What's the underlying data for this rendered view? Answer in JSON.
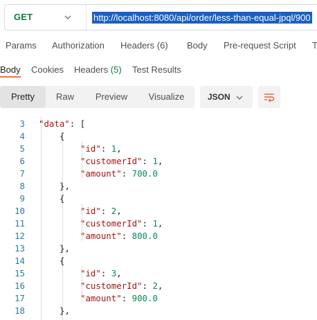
{
  "request": {
    "method": "GET",
    "url": "http://localhost:8080/api/order/less-than-equal-jpql/900"
  },
  "request_tabs": [
    {
      "label": "Params"
    },
    {
      "label": "Authorization"
    },
    {
      "label": "Headers",
      "count": "(6)"
    },
    {
      "label": "Body"
    },
    {
      "label": "Pre-request Script"
    },
    {
      "label": "T"
    }
  ],
  "response_tabs": [
    {
      "label": "Body",
      "active": true
    },
    {
      "label": "Cookies"
    },
    {
      "label": "Headers",
      "count": "(5)"
    },
    {
      "label": "Test Results"
    }
  ],
  "view_modes": [
    "Pretty",
    "Raw",
    "Preview",
    "Visualize"
  ],
  "active_view": "Pretty",
  "format": "JSON",
  "code_lines": [
    {
      "n": "3",
      "key": "\"data\"",
      "rest": ": ["
    },
    {
      "n": "4",
      "text": "{"
    },
    {
      "n": "5",
      "key": "\"id\"",
      "sep": ": ",
      "val": "1",
      "end": ","
    },
    {
      "n": "6",
      "key": "\"customerId\"",
      "sep": ": ",
      "val": "1",
      "end": ","
    },
    {
      "n": "7",
      "key": "\"amount\"",
      "sep": ": ",
      "val": "700.0",
      "end": ""
    },
    {
      "n": "8",
      "text": "},"
    },
    {
      "n": "9",
      "text": "{"
    },
    {
      "n": "10",
      "key": "\"id\"",
      "sep": ": ",
      "val": "2",
      "end": ","
    },
    {
      "n": "11",
      "key": "\"customerId\"",
      "sep": ": ",
      "val": "1",
      "end": ","
    },
    {
      "n": "12",
      "key": "\"amount\"",
      "sep": ": ",
      "val": "800.0",
      "end": ""
    },
    {
      "n": "13",
      "text": "},"
    },
    {
      "n": "14",
      "text": "{"
    },
    {
      "n": "15",
      "key": "\"id\"",
      "sep": ": ",
      "val": "3",
      "end": ","
    },
    {
      "n": "16",
      "key": "\"customerId\"",
      "sep": ": ",
      "val": "2",
      "end": ","
    },
    {
      "n": "17",
      "key": "\"amount\"",
      "sep": ": ",
      "val": "900.0",
      "end": ""
    },
    {
      "n": "18",
      "text": "},"
    }
  ],
  "colors": {
    "method": "#0f7b3c",
    "url_highlight": "#1b5fc1",
    "json_key": "#a31515",
    "json_number": "#098658",
    "line_number": "#2c7da0",
    "accent": "#ff6c37"
  }
}
